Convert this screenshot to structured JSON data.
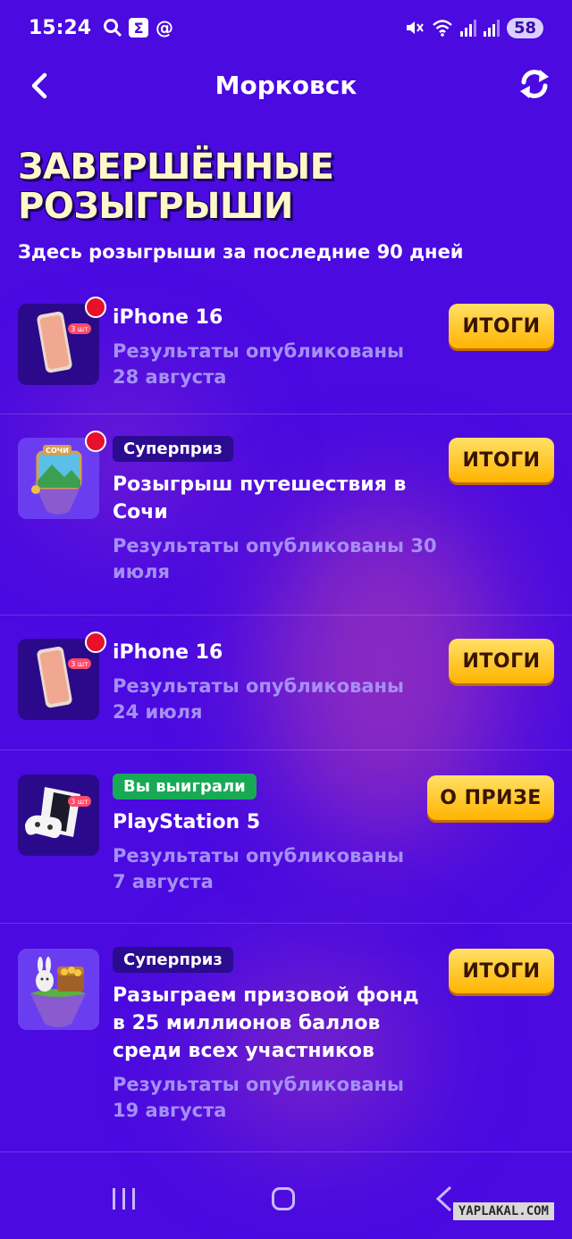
{
  "status_bar": {
    "time": "15:24",
    "battery": "58",
    "icons_left": [
      "search-icon",
      "sigma-box-icon",
      "at-icon"
    ],
    "icons_right": [
      "mute-icon",
      "wifi-icon",
      "signal-icon",
      "signal-icon"
    ]
  },
  "nav": {
    "title": "Морковск",
    "back_icon": "chevron-left-icon",
    "refresh_icon": "refresh-icon"
  },
  "page": {
    "title": "Завершённые розыгрыши",
    "subtitle": "Здесь розыгрыши за последние 90 дней"
  },
  "items": [
    {
      "title": "iPhone 16",
      "meta": "Результаты опубликованы 28 августа",
      "action": "ИТОГИ",
      "badge": "",
      "new_dot": true,
      "thumb": "iphone-icon"
    },
    {
      "title": "Розыгрыш путешествия в Сочи",
      "meta": "Результаты опубликованы 30 июля",
      "action": "ИТОГИ",
      "badge": "Суперприз",
      "new_dot": true,
      "thumb": "sochi-island-icon",
      "thumb_label": "СОЧИ"
    },
    {
      "title": "iPhone 16",
      "meta": "Результаты опубликованы 24 июля",
      "action": "ИТОГИ",
      "badge": "",
      "new_dot": true,
      "thumb": "iphone-icon"
    },
    {
      "title": "PlayStation 5",
      "meta": "Результаты опубликованы 7 августа",
      "action": "О ПРИЗЕ",
      "badge": "Вы выиграли",
      "new_dot": false,
      "thumb": "playstation-icon"
    },
    {
      "title": "Разыграем призовой фонд в 25 миллионов баллов среди всех участников",
      "meta": "Результаты опубликованы 19 августа",
      "action": "ИТОГИ",
      "badge": "Суперприз",
      "new_dot": false,
      "thumb": "treasure-island-icon"
    }
  ],
  "thumb_tag": "3 шт",
  "watermark": "YAPLAKAL.COM",
  "colors": {
    "background": "#4a0ae0",
    "button": "#ffc21a",
    "meta_text": "#a68ff5",
    "badge_dark": "#2b0b8f",
    "badge_green": "#18a955",
    "title_text": "#fff7c8"
  }
}
